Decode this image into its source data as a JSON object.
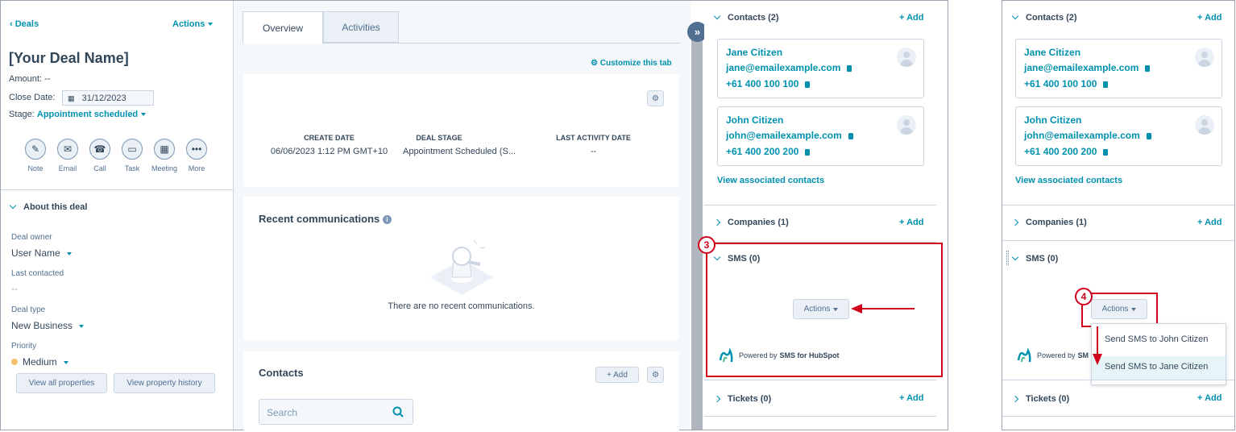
{
  "left": {
    "back_label": "Deals",
    "actions_label": "Actions",
    "deal_name": "[Your Deal Name]",
    "amount_label": "Amount:",
    "amount_value": "--",
    "close_date_label": "Close Date:",
    "close_date_value": "31/12/2023",
    "stage_label": "Stage:",
    "stage_value": "Appointment scheduled",
    "activity_buttons": [
      {
        "label": "Note",
        "icon": "note-icon"
      },
      {
        "label": "Email",
        "icon": "email-icon"
      },
      {
        "label": "Call",
        "icon": "call-icon"
      },
      {
        "label": "Task",
        "icon": "task-icon"
      },
      {
        "label": "Meeting",
        "icon": "meeting-icon"
      },
      {
        "label": "More",
        "icon": "more-icon"
      }
    ],
    "about_title": "About this deal",
    "properties": [
      {
        "label": "Deal owner",
        "value": "User Name"
      },
      {
        "label": "Last contacted",
        "value": "--"
      },
      {
        "label": "Deal type",
        "value": "New Business"
      },
      {
        "label": "Priority",
        "value": "Medium"
      }
    ],
    "view_all_label": "View all properties",
    "view_history_label": "View property history"
  },
  "middle": {
    "tabs": [
      {
        "label": "Overview"
      },
      {
        "label": "Activities"
      }
    ],
    "customize_label": "Customize this tab",
    "stats": [
      {
        "header": "CREATE DATE",
        "value": "06/06/2023 1:12 PM GMT+10"
      },
      {
        "header": "DEAL STAGE",
        "value": "Appointment Scheduled (S..."
      },
      {
        "header": "LAST ACTIVITY DATE",
        "value": "--"
      }
    ],
    "recent_title": "Recent communications",
    "recent_empty": "There are no recent communications.",
    "contacts_title": "Contacts",
    "add_label": "+ Add",
    "search_placeholder": "Search"
  },
  "right": {
    "contacts_title": "Contacts (2)",
    "add_label": "+ Add",
    "contacts": [
      {
        "name": "Jane Citizen",
        "email": "jane@emailexample.com",
        "phone": "+61 400 100 100"
      },
      {
        "name": "John Citizen",
        "email": "john@emailexample.com",
        "phone": "+61 400 200 200"
      }
    ],
    "view_associated": "View associated contacts",
    "companies_title": "Companies (1)",
    "sms_title": "SMS (0)",
    "actions_label": "Actions",
    "powered_prefix": "Powered by",
    "powered_brand": "SMS for HubSpot",
    "tickets_title": "Tickets (0)",
    "step_badge": "3"
  },
  "far_right": {
    "contacts_title": "Contacts (2)",
    "add_label": "+ Add",
    "view_associated": "View associated contacts",
    "companies_title": "Companies (1)",
    "sms_title": "SMS (0)",
    "actions_label": "Actions",
    "powered_prefix": "Powered by",
    "powered_brand_partial": "SM",
    "tickets_title": "Tickets (0)",
    "step_badge": "4",
    "dropdown": [
      {
        "label": "Send SMS to John Citizen"
      },
      {
        "label": "Send SMS to Jane Citizen"
      }
    ]
  },
  "colors": {
    "accent": "#0091ae",
    "annotation": "#d0021b",
    "text": "#33475b"
  }
}
